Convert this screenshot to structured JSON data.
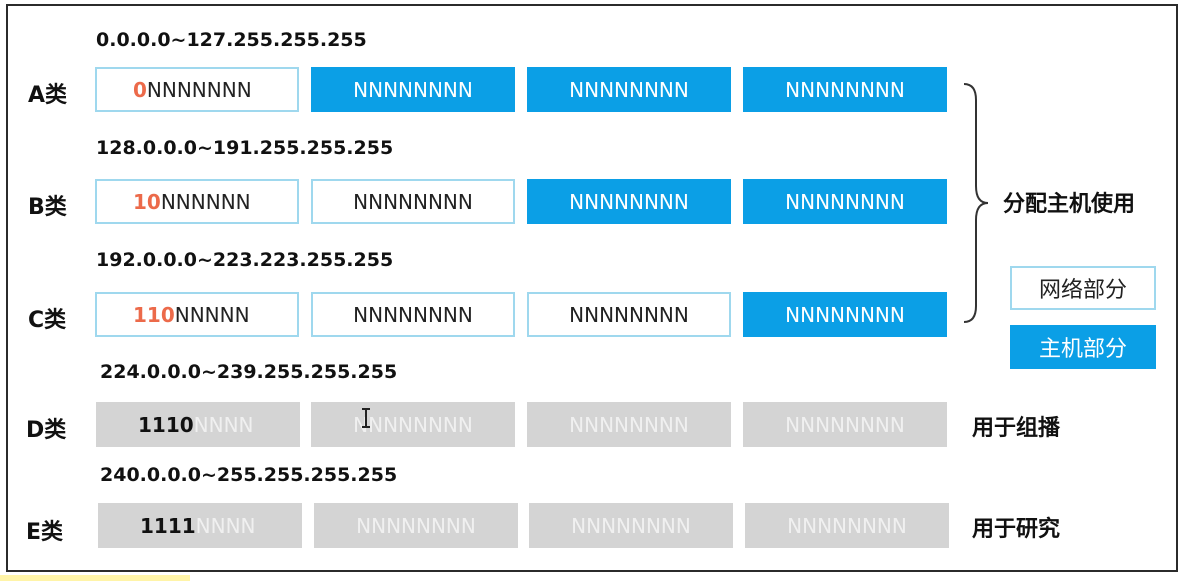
{
  "classes": [
    {
      "label": "A类",
      "range": "0.0.0.0~127.255.255.255",
      "octets": [
        {
          "bits": "0",
          "rest": "NNNNNNN",
          "kind": "net"
        },
        {
          "bits": "",
          "rest": "NNNNNNNN",
          "kind": "host"
        },
        {
          "bits": "",
          "rest": "NNNNNNNN",
          "kind": "host"
        },
        {
          "bits": "",
          "rest": "NNNNNNNN",
          "kind": "host"
        }
      ]
    },
    {
      "label": "B类",
      "range": "128.0.0.0~191.255.255.255",
      "octets": [
        {
          "bits": "10",
          "rest": "NNNNNN",
          "kind": "net"
        },
        {
          "bits": "",
          "rest": "NNNNNNNN",
          "kind": "net"
        },
        {
          "bits": "",
          "rest": "NNNNNNNN",
          "kind": "host"
        },
        {
          "bits": "",
          "rest": "NNNNNNNN",
          "kind": "host"
        }
      ]
    },
    {
      "label": "C类",
      "range": "192.0.0.0~223.223.255.255",
      "octets": [
        {
          "bits": "110",
          "rest": "NNNNN",
          "kind": "net"
        },
        {
          "bits": "",
          "rest": "NNNNNNNN",
          "kind": "net"
        },
        {
          "bits": "",
          "rest": "NNNNNNNN",
          "kind": "net"
        },
        {
          "bits": "",
          "rest": "NNNNNNNN",
          "kind": "host"
        }
      ]
    },
    {
      "label": "D类",
      "range": "224.0.0.0~239.255.255.255",
      "octets": [
        {
          "bits": "1110",
          "rest": "NNNN",
          "kind": "gray"
        },
        {
          "bits": "",
          "rest": "NNNNNNNN",
          "kind": "gray"
        },
        {
          "bits": "",
          "rest": "NNNNNNNN",
          "kind": "gray"
        },
        {
          "bits": "",
          "rest": "NNNNNNNN",
          "kind": "gray"
        }
      ],
      "note": "用于组播"
    },
    {
      "label": "E类",
      "range": "240.0.0.0~255.255.255.255",
      "octets": [
        {
          "bits": "1111",
          "rest": "NNNN",
          "kind": "gray"
        },
        {
          "bits": "",
          "rest": "NNNNNNNN",
          "kind": "gray"
        },
        {
          "bits": "",
          "rest": "NNNNNNNN",
          "kind": "gray"
        },
        {
          "bits": "",
          "rest": "NNNNNNNN",
          "kind": "gray"
        }
      ],
      "note": "用于研究"
    }
  ],
  "brace_label": "分配主机使用",
  "legend": {
    "network": "网络部分",
    "host": "主机部分"
  },
  "colors": {
    "host": "#0b9fe6",
    "network_border": "#9fd8ee",
    "prefix_bits": "#ec6a4a",
    "reserved": "#d4d4d4"
  }
}
